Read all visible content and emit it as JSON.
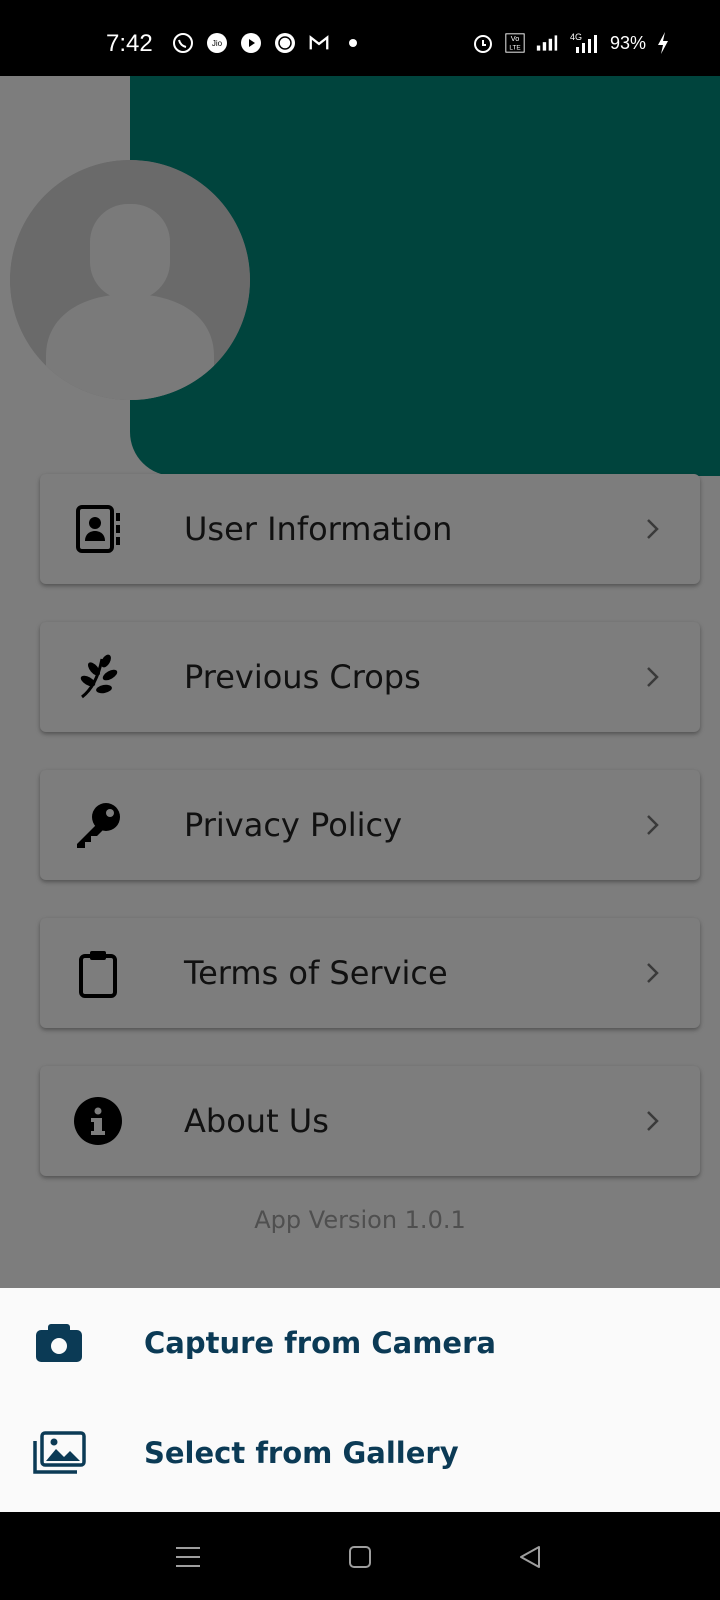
{
  "status_bar": {
    "time": "7:42",
    "battery": "93%",
    "left_icons": [
      "whatsapp-icon",
      "jio-icon",
      "play-icon",
      "rpe-icon",
      "gmail-icon",
      "dot-icon"
    ],
    "right_icons": [
      "alarm-icon",
      "volte-icon",
      "signal-icon",
      "4g-signal-icon",
      "charging-icon"
    ],
    "network_label": "4G"
  },
  "profile": {
    "avatar_icon": "person-avatar-icon"
  },
  "menu": {
    "items": [
      {
        "label": "User Information",
        "icon": "contact-card-icon"
      },
      {
        "label": "Previous Crops",
        "icon": "plant-icon"
      },
      {
        "label": "Privacy Policy",
        "icon": "key-icon"
      },
      {
        "label": "Terms of Service",
        "icon": "clipboard-icon"
      },
      {
        "label": "About Us",
        "icon": "info-icon"
      }
    ]
  },
  "app_version": "App Version 1.0.1",
  "bottom_sheet": {
    "options": [
      {
        "label": "Capture from Camera",
        "icon": "camera-icon"
      },
      {
        "label": "Select from Gallery",
        "icon": "gallery-icon"
      }
    ]
  },
  "colors": {
    "header": "#00897b",
    "sheet_text": "#0b3a55",
    "scrim": "rgba(0,0,0,0.5)"
  }
}
